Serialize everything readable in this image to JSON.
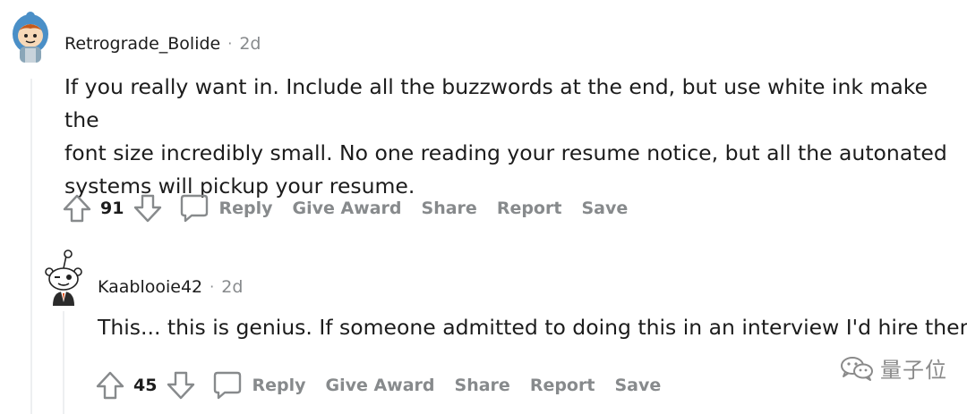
{
  "comments": [
    {
      "username": "Retrograde_Bolide",
      "separator": "·",
      "time": "2d",
      "body": "If you really want in. Include all the buzzwords at the end, but use white ink make the\nfont size incredibly small. No one reading your resume notice, but all the autonated\nsystems will pickup your resume.",
      "votes": "91",
      "actions": {
        "reply": "Reply",
        "give_award": "Give Award",
        "share": "Share",
        "report": "Report",
        "save": "Save"
      }
    },
    {
      "username": "Kaablooie42",
      "separator": "·",
      "time": "2d",
      "body": "This... this is genius. If someone admitted to doing this in an interview I'd hire them.",
      "votes": "45",
      "actions": {
        "reply": "Reply",
        "give_award": "Give Award",
        "share": "Share",
        "report": "Report",
        "save": "Save"
      }
    }
  ],
  "watermark": {
    "text": "量子位",
    "icon": "wechat-logo-icon"
  },
  "colors": {
    "text": "#1c1c1c",
    "meta": "#878a8c",
    "thread_line": "#edeff1",
    "avatar_bg": "#dae0e6"
  }
}
